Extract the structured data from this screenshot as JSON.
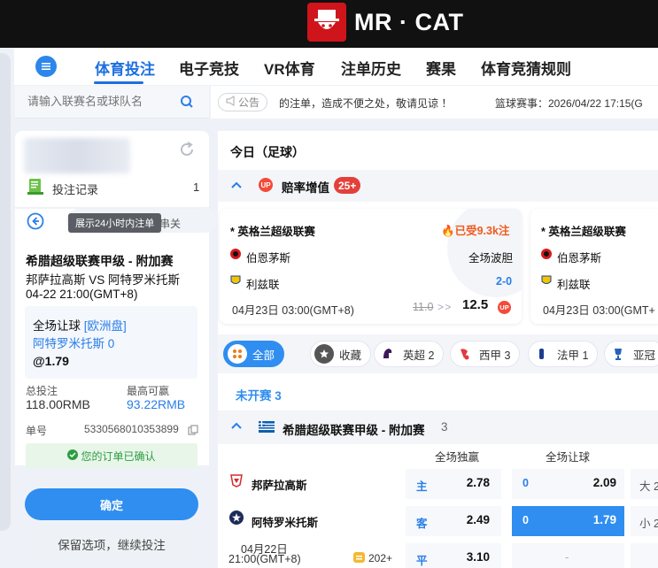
{
  "brand": {
    "title": "MR · CAT",
    "accent": "#d0141b"
  },
  "nav": {
    "tabs": [
      {
        "label": "体育投注",
        "active": true
      },
      {
        "label": "电子竞技"
      },
      {
        "label": "VR体育"
      },
      {
        "label": "注单历史"
      },
      {
        "label": "赛果"
      },
      {
        "label": "体育竞猜规则"
      }
    ]
  },
  "search": {
    "placeholder": "请输入联赛名或球队名"
  },
  "bet_record": {
    "label": "投注记录",
    "count": "1"
  },
  "slip": {
    "tooltip": "展示24小时内注单",
    "tab_right": "串关",
    "league": "希腊超级联赛甲级 - 附加赛",
    "match": "邦萨拉高斯 VS 阿特罗米托斯",
    "time": "04-22 21:00(GMT+8)",
    "bet_type": "全场让球",
    "market": "[欧洲盘]",
    "selection": "阿特罗米托斯 0",
    "odds": "@1.79",
    "total_label": "总投注",
    "total_value": "118.00RMB",
    "maxwin_label": "最高可赢",
    "maxwin_value": "93.22RMB",
    "order_label": "单号",
    "order_value": "5330568010353899",
    "confirmed_text": "您的订单已确认"
  },
  "buttons": {
    "confirm": "确定",
    "keep": "保留选项，继续投注"
  },
  "notice": {
    "pill": "公告",
    "text": "的注单，造成不便之处，敬请见谅 ！",
    "right": "篮球赛事：2026/04/22 17:15(G"
  },
  "main": {
    "today_title": "今日（足球）",
    "boost_title": "赔率增值",
    "boost_count": "25+",
    "card1": {
      "league": "* 英格兰超级联赛",
      "hot": "已受9.3k注",
      "team1": "伯恩茅斯",
      "team2": "利兹联",
      "market": "全场波胆",
      "score": "2-0",
      "date": "04月23日 03:00(GMT+8)",
      "old_odds": "11.0",
      "arrows": "> >",
      "new_odds": "12.5",
      "up": "UP"
    },
    "card2": {
      "league": "* 英格兰超级联赛",
      "team1": "伯恩茅斯",
      "team2": "利兹联",
      "date": "04月23日 03:00(GMT+"
    },
    "filters": [
      {
        "label": "全部",
        "active": true
      },
      {
        "label": "收藏"
      },
      {
        "label": "英超 2"
      },
      {
        "label": "西甲 3"
      },
      {
        "label": "法甲 1"
      },
      {
        "label": "亚冠"
      }
    ],
    "not_started": "未开赛 3",
    "league_title": "希腊超级联赛甲级 - 附加赛",
    "league_count": "3",
    "col1": "全场独赢",
    "col2": "全场让球",
    "team_a": "邦萨拉高斯",
    "team_b": "阿特罗米托斯",
    "match_date": "04月22日",
    "match_time": "21:00(GMT+8)",
    "more_count": "202+",
    "odds": [
      {
        "label": "主",
        "value": "2.78",
        "hc": "0",
        "hc_value": "2.09",
        "ou": "大 2"
      },
      {
        "label": "客",
        "value": "2.49",
        "hc": "0",
        "hc_value": "1.79",
        "ou": "小 2",
        "selected": true
      },
      {
        "label": "平",
        "value": "3.10",
        "hc": "",
        "hc_value": "-",
        "ou": ""
      }
    ]
  },
  "up_badge": "UP"
}
